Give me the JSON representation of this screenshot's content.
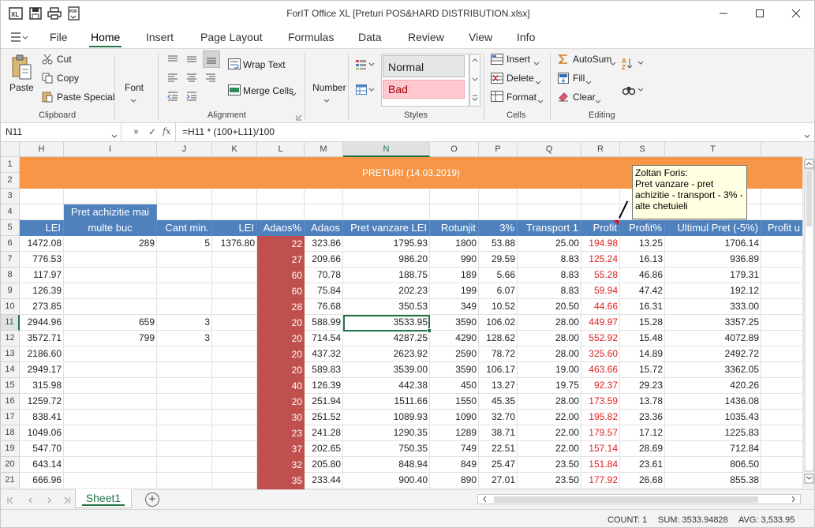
{
  "window": {
    "title": "ForIT Office XL [Preturi POS&HARD DISTRIBUTION.xlsx]",
    "quick_access": [
      "xls-icon",
      "save-icon",
      "print-icon",
      "pdf-icon"
    ],
    "controls": [
      "minimize-icon",
      "maximize-icon",
      "close-icon"
    ]
  },
  "menu": {
    "tabs": [
      "File",
      "Home",
      "Insert",
      "Page Layout",
      "Formulas",
      "Data",
      "Review",
      "View",
      "Info"
    ],
    "active": "Home"
  },
  "ribbon": {
    "clipboard": {
      "paste": "Paste",
      "cut": "Cut",
      "copy": "Copy",
      "paste_special": "Paste Special",
      "label": "Clipboard"
    },
    "font": {
      "label": "Font"
    },
    "alignment": {
      "wrap_text": "Wrap Text",
      "merge_cells": "Merge Cells",
      "label": "Alignment"
    },
    "number": {
      "label": "Number"
    },
    "styles": {
      "normal": "Normal",
      "bad": "Bad",
      "label": "Styles"
    },
    "cells": {
      "insert": "Insert",
      "delete": "Delete",
      "format": "Format",
      "label": "Cells"
    },
    "editing": {
      "autosum": "AutoSum",
      "fill": "Fill",
      "clear": "Clear",
      "label": "Editing"
    }
  },
  "formula_bar": {
    "name_box": "N11",
    "cancel": "×",
    "enter": "✓",
    "fx": "fx",
    "formula": "=H11 * (100+L11)/100"
  },
  "grid": {
    "columns": [
      "H",
      "I",
      "J",
      "K",
      "L",
      "M",
      "N",
      "O",
      "P",
      "Q",
      "R",
      "S",
      "T"
    ],
    "selected_column": "N",
    "selected_row": "11",
    "banner": "PRETURI (14.03.2019)",
    "i4_header": "Pret achizitie mai multe buc",
    "headers": {
      "H": "LEI",
      "J": "Cant min.",
      "K": "LEI",
      "L": "Adaos%",
      "M": "Adaos",
      "N": "Pret vanzare LEI",
      "O": "Rotunjit",
      "P": "3%",
      "Q": "Transport 1",
      "R": "Profit",
      "S": "Profit%",
      "T": "Ultimul Pret (-5%)",
      "U": "Profit u"
    },
    "comment": {
      "author": "Zoltan Foris:",
      "text": "Pret vanzare - pret achizitie - transport - 3% - alte chetuieli"
    },
    "rows": [
      {
        "n": "6",
        "H": "1472.08",
        "I": "289",
        "J": "5",
        "K": "1376.80",
        "L": "22",
        "M": "323.86",
        "N": "1795.93",
        "O": "1800",
        "P": "53.88",
        "Q": "25.00",
        "R": "194.98",
        "S": "13.25",
        "T": "1706.14"
      },
      {
        "n": "7",
        "H": "776.53",
        "I": "",
        "J": "",
        "K": "",
        "L": "27",
        "M": "209.66",
        "N": "986.20",
        "O": "990",
        "P": "29.59",
        "Q": "8.83",
        "R": "125.24",
        "S": "16.13",
        "T": "936.89"
      },
      {
        "n": "8",
        "H": "117.97",
        "I": "",
        "J": "",
        "K": "",
        "L": "60",
        "M": "70.78",
        "N": "188.75",
        "O": "189",
        "P": "5.66",
        "Q": "8.83",
        "R": "55.28",
        "S": "46.86",
        "T": "179.31"
      },
      {
        "n": "9",
        "H": "126.39",
        "I": "",
        "J": "",
        "K": "",
        "L": "60",
        "M": "75.84",
        "N": "202.23",
        "O": "199",
        "P": "6.07",
        "Q": "8.83",
        "R": "59.94",
        "S": "47.42",
        "T": "192.12"
      },
      {
        "n": "10",
        "H": "273.85",
        "I": "",
        "J": "",
        "K": "",
        "L": "28",
        "M": "76.68",
        "N": "350.53",
        "O": "349",
        "P": "10.52",
        "Q": "20.50",
        "R": "44.66",
        "S": "16.31",
        "T": "333.00"
      },
      {
        "n": "11",
        "H": "2944.96",
        "I": "659",
        "J": "3",
        "K": "",
        "L": "20",
        "M": "588.99",
        "N": "3533.95",
        "O": "3590",
        "P": "106.02",
        "Q": "28.00",
        "R": "449.97",
        "S": "15.28",
        "T": "3357.25"
      },
      {
        "n": "12",
        "H": "3572.71",
        "I": "799",
        "J": "3",
        "K": "",
        "L": "20",
        "M": "714.54",
        "N": "4287.25",
        "O": "4290",
        "P": "128.62",
        "Q": "28.00",
        "R": "552.92",
        "S": "15.48",
        "T": "4072.89"
      },
      {
        "n": "13",
        "H": "2186.60",
        "I": "",
        "J": "",
        "K": "",
        "L": "20",
        "M": "437.32",
        "N": "2623.92",
        "O": "2590",
        "P": "78.72",
        "Q": "28.00",
        "R": "325.60",
        "S": "14.89",
        "T": "2492.72"
      },
      {
        "n": "14",
        "H": "2949.17",
        "I": "",
        "J": "",
        "K": "",
        "L": "20",
        "M": "589.83",
        "N": "3539.00",
        "O": "3590",
        "P": "106.17",
        "Q": "19.00",
        "R": "463.66",
        "S": "15.72",
        "T": "3362.05"
      },
      {
        "n": "15",
        "H": "315.98",
        "I": "",
        "J": "",
        "K": "",
        "L": "40",
        "M": "126.39",
        "N": "442.38",
        "O": "450",
        "P": "13.27",
        "Q": "19.75",
        "R": "92.37",
        "S": "29.23",
        "T": "420.26"
      },
      {
        "n": "16",
        "H": "1259.72",
        "I": "",
        "J": "",
        "K": "",
        "L": "20",
        "M": "251.94",
        "N": "1511.66",
        "O": "1550",
        "P": "45.35",
        "Q": "28.00",
        "R": "173.59",
        "S": "13.78",
        "T": "1436.08"
      },
      {
        "n": "17",
        "H": "838.41",
        "I": "",
        "J": "",
        "K": "",
        "L": "30",
        "M": "251.52",
        "N": "1089.93",
        "O": "1090",
        "P": "32.70",
        "Q": "22.00",
        "R": "195.82",
        "S": "23.36",
        "T": "1035.43"
      },
      {
        "n": "18",
        "H": "1049.06",
        "I": "",
        "J": "",
        "K": "",
        "L": "23",
        "M": "241.28",
        "N": "1290.35",
        "O": "1289",
        "P": "38.71",
        "Q": "22.00",
        "R": "179.57",
        "S": "17.12",
        "T": "1225.83"
      },
      {
        "n": "19",
        "H": "547.70",
        "I": "",
        "J": "",
        "K": "",
        "L": "37",
        "M": "202.65",
        "N": "750.35",
        "O": "749",
        "P": "22.51",
        "Q": "22.00",
        "R": "157.14",
        "S": "28.69",
        "T": "712.84"
      },
      {
        "n": "20",
        "H": "643.14",
        "I": "",
        "J": "",
        "K": "",
        "L": "32",
        "M": "205.80",
        "N": "848.94",
        "O": "849",
        "P": "25.47",
        "Q": "23.50",
        "R": "151.84",
        "S": "23.61",
        "T": "806.50"
      },
      {
        "n": "21",
        "H": "666.96",
        "I": "",
        "J": "",
        "K": "",
        "L": "35",
        "M": "233.44",
        "N": "900.40",
        "O": "890",
        "P": "27.01",
        "Q": "23.50",
        "R": "177.92",
        "S": "26.68",
        "T": "855.38"
      }
    ]
  },
  "sheets": {
    "tabs": [
      "Sheet1"
    ],
    "active": "Sheet1",
    "add": "+"
  },
  "status": {
    "count": "COUNT: 1",
    "sum": "SUM: 3533.94828",
    "avg": "AVG: 3,533.95"
  },
  "colors": {
    "accent": "#217346",
    "banner": "#f79646",
    "header_blue": "#4f81bd",
    "adaos_red": "#c0504d",
    "profit_red": "#e02020"
  }
}
